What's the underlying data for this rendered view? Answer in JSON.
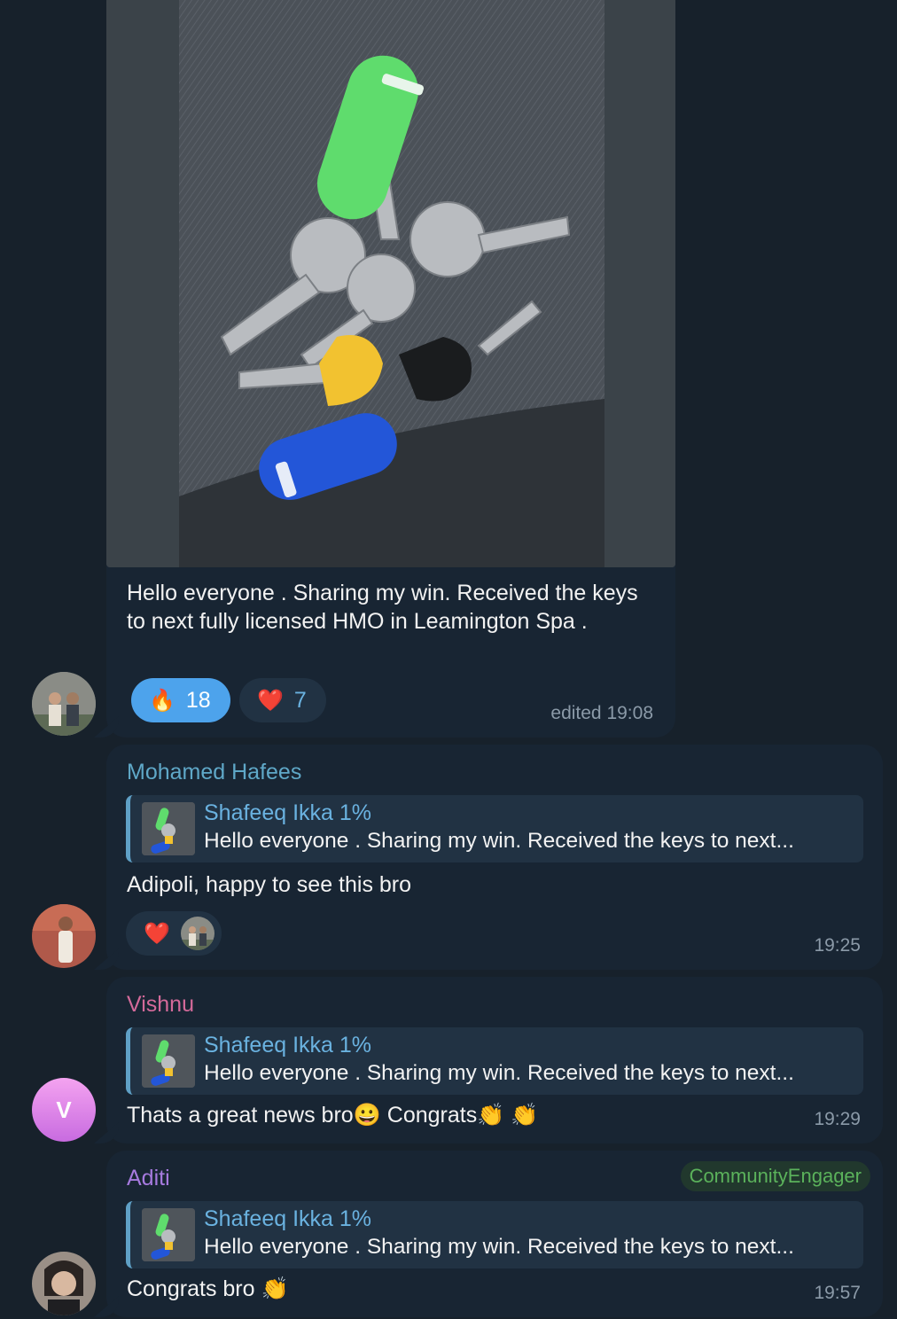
{
  "messages": [
    {
      "text": "Hello everyone . Sharing my win. Received the keys to next fully licensed HMO in Leamington Spa .",
      "reactions": [
        {
          "emoji": "🔥",
          "count": "18"
        },
        {
          "emoji": "❤️",
          "count": "7"
        }
      ],
      "time": "edited 19:08"
    },
    {
      "sender": "Mohamed Hafees",
      "reply": {
        "name": "Shafeeq Ikka 1%",
        "text": "Hello everyone . Sharing my win. Received the keys to next..."
      },
      "text": "Adipoli, happy to see this bro",
      "reaction_emoji": "❤️",
      "time": "19:25"
    },
    {
      "sender": "Vishnu",
      "avatar_letter": "V",
      "reply": {
        "name": "Shafeeq Ikka 1%",
        "text": "Hello everyone . Sharing my win. Received the keys to next..."
      },
      "text": "Thats a great news bro😀 Congrats👏 👏",
      "time": "19:29"
    },
    {
      "sender": "Aditi",
      "badge": "CommunityEngager",
      "reply": {
        "name": "Shafeeq Ikka 1%",
        "text": "Hello everyone . Sharing my win. Received the keys to next..."
      },
      "text": "Congrats bro 👏",
      "time": "19:57"
    }
  ],
  "colors": {
    "background": "#17212b",
    "bubble": "#182533",
    "reply_accent": "#6ab2e0",
    "sender_hafees": "#5fa8c8",
    "sender_vishnu": "#d46a9a",
    "sender_aditi": "#a67adf",
    "badge_text": "#5bb25b",
    "reaction_active": "#4da3ec"
  }
}
